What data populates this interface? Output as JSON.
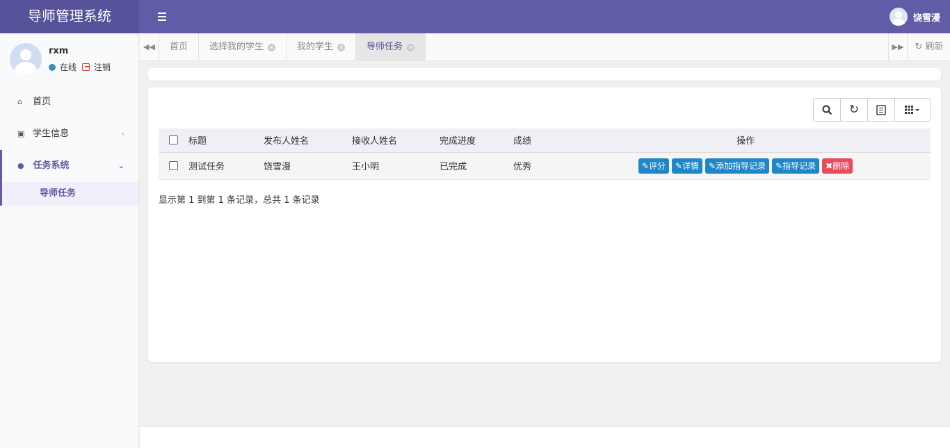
{
  "app": {
    "title": "导师管理系统"
  },
  "header": {
    "username": "饶雪漫"
  },
  "sidebar": {
    "user": {
      "name": "rxm",
      "status": "在线",
      "logout": "注销"
    },
    "items": [
      {
        "label": "首页",
        "icon": "home-icon"
      },
      {
        "label": "学生信息",
        "icon": "id-card-icon"
      },
      {
        "label": "任务系统",
        "icon": "tint-icon"
      }
    ],
    "subitems": [
      {
        "label": "导师任务"
      }
    ]
  },
  "tabs": {
    "items": [
      {
        "label": "首页",
        "closable": false
      },
      {
        "label": "选择我的学生",
        "closable": true
      },
      {
        "label": "我的学生",
        "closable": true
      },
      {
        "label": "导师任务",
        "closable": true,
        "active": true
      }
    ],
    "refresh": "刷新"
  },
  "toolbar": {
    "buttons": [
      "search-icon",
      "refresh-icon",
      "list-icon",
      "columns-icon"
    ]
  },
  "table": {
    "headers": [
      "标题",
      "发布人姓名",
      "接收人姓名",
      "完成进度",
      "成绩",
      "操作"
    ],
    "rows": [
      {
        "title": "测试任务",
        "publisher": "饶雪漫",
        "receiver": "王小明",
        "progress": "已完成",
        "score": "优秀",
        "actions": [
          "评分",
          "详情",
          "添加指导记录",
          "指导记录",
          "删除"
        ]
      }
    ]
  },
  "pagination": {
    "info": "显示第 1 到第 1 条记录，总共 1 条记录"
  },
  "colors": {
    "primary": "#605ca8",
    "logo_bg": "#555299",
    "action_blue": "#1f86c8",
    "danger": "#e74c5d"
  }
}
